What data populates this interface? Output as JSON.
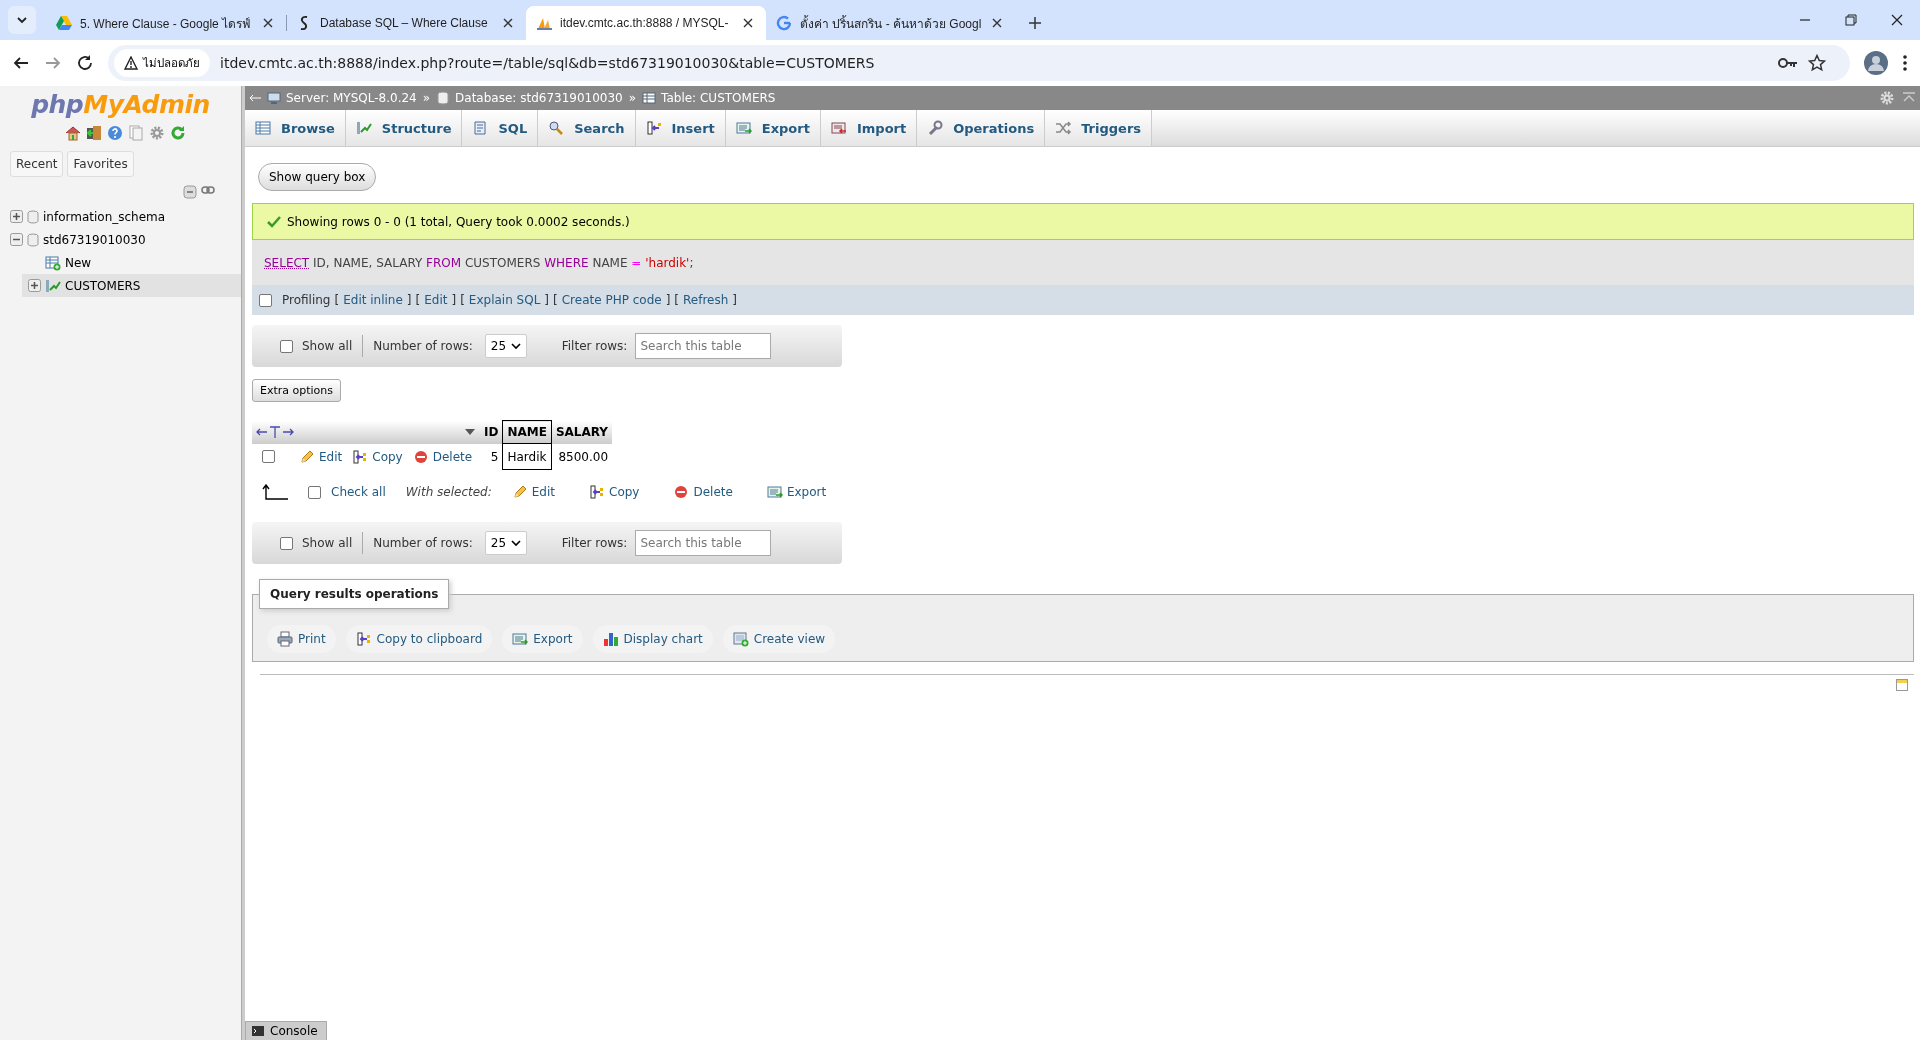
{
  "browser": {
    "tabs": [
      {
        "title": "5. Where Clause - Google ไดรฟ์",
        "kind": "drive",
        "selected": false
      },
      {
        "title": "Database SQL – Where Clause",
        "kind": "swirl",
        "selected": false
      },
      {
        "title": "itdev.cmtc.ac.th:8888 / MYSQL-",
        "kind": "pma",
        "selected": true
      },
      {
        "title": "ตั้งค่า ปริ้นสกริน - ค้นหาด้วย Googl",
        "kind": "google",
        "selected": false
      }
    ],
    "security_label": "ไม่ปลอดภัย",
    "url": "itdev.cmtc.ac.th:8888/index.php?route=/table/sql&db=std67319010030&table=CUSTOMERS"
  },
  "sidebar": {
    "logo_php": "php",
    "logo_myadmin": "MyAdmin",
    "tabs": [
      "Recent",
      "Favorites"
    ],
    "tree": [
      {
        "label": "information_schema",
        "kind": "database",
        "expanded": false,
        "selected": false
      },
      {
        "label": "std67319010030",
        "kind": "database",
        "expanded": true,
        "selected": false,
        "children": [
          {
            "label": "New",
            "kind": "new",
            "selected": false
          },
          {
            "label": "CUSTOMERS",
            "kind": "table",
            "expanded": false,
            "selected": true
          }
        ]
      }
    ]
  },
  "breadcrumb": [
    {
      "label": "Server: MYSQL-8.0.24",
      "kind": "server"
    },
    {
      "label": "Database: std67319010030",
      "kind": "database"
    },
    {
      "label": "Table: CUSTOMERS",
      "kind": "table"
    }
  ],
  "breadcrumb_separator": "»",
  "menu_tabs": [
    {
      "label": "Browse",
      "kind": "browse"
    },
    {
      "label": "Structure",
      "kind": "structure"
    },
    {
      "label": "SQL",
      "kind": "sql"
    },
    {
      "label": "Search",
      "kind": "search"
    },
    {
      "label": "Insert",
      "kind": "insert"
    },
    {
      "label": "Export",
      "kind": "export"
    },
    {
      "label": "Import",
      "kind": "import"
    },
    {
      "label": "Operations",
      "kind": "operations"
    },
    {
      "label": "Triggers",
      "kind": "triggers"
    }
  ],
  "show_query_button": "Show query box",
  "success_message": "Showing rows 0 - 0 (1 total, Query took 0.0002 seconds.)",
  "sql_query": [
    {
      "text": "SELECT",
      "kind": "keyword_link"
    },
    {
      "text": " ID, NAME, SALARY ",
      "kind": "plain"
    },
    {
      "text": "FROM",
      "kind": "keyword"
    },
    {
      "text": " CUSTOMERS ",
      "kind": "plain"
    },
    {
      "text": "WHERE",
      "kind": "keyword"
    },
    {
      "text": " NAME ",
      "kind": "plain"
    },
    {
      "text": "=",
      "kind": "operator"
    },
    {
      "text": " 'hardik'",
      "kind": "string"
    },
    {
      "text": ";",
      "kind": "plain"
    }
  ],
  "profiling": {
    "label": "Profiling",
    "checked": false,
    "open": "[",
    "close": "]",
    "links": [
      "Edit inline",
      "Edit",
      "Explain SQL",
      "Create PHP code",
      "Refresh"
    ]
  },
  "navigation": [
    {
      "show_all_label": "Show all",
      "show_all_checked": false,
      "rows_label": "Number of rows:",
      "rows_value": "25",
      "filter_label": "Filter rows:",
      "filter_placeholder": "Search this table"
    },
    {
      "show_all_label": "Show all",
      "show_all_checked": false,
      "rows_label": "Number of rows:",
      "rows_value": "25",
      "filter_label": "Filter rows:",
      "filter_placeholder": "Search this table"
    }
  ],
  "extra_options": "Extra options",
  "results": {
    "columns": [
      {
        "label": "ID",
        "marked": false
      },
      {
        "label": "NAME",
        "marked": true
      },
      {
        "label": "SALARY",
        "marked": false
      }
    ],
    "rows": [
      {
        "checked": false,
        "actions": [
          {
            "label": "Edit",
            "kind": "edit"
          },
          {
            "label": "Copy",
            "kind": "copy"
          },
          {
            "label": "Delete",
            "kind": "delete"
          }
        ],
        "cells": [
          "5",
          "Hardik",
          "8500.00"
        ]
      }
    ]
  },
  "with_selected": {
    "check_all_label": "Check all",
    "checked": false,
    "label": "With selected:",
    "actions": [
      {
        "label": "Edit",
        "kind": "edit"
      },
      {
        "label": "Copy",
        "kind": "copy"
      },
      {
        "label": "Delete",
        "kind": "delete"
      },
      {
        "label": "Export",
        "kind": "export"
      }
    ]
  },
  "query_results_operations": {
    "legend": "Query results operations",
    "actions": [
      {
        "label": "Print",
        "kind": "print"
      },
      {
        "label": "Copy to clipboard",
        "kind": "copy"
      },
      {
        "label": "Export",
        "kind": "export"
      },
      {
        "label": "Display chart",
        "kind": "chart"
      },
      {
        "label": "Create view",
        "kind": "view"
      }
    ]
  },
  "console": "Console"
}
